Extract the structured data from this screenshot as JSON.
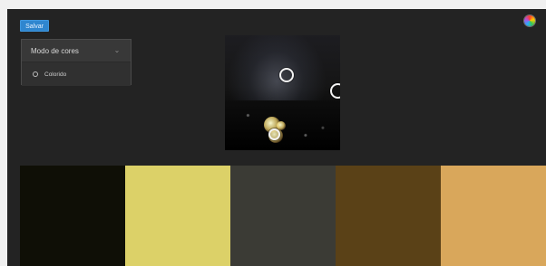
{
  "toolbar": {
    "save_label": "Salvar"
  },
  "settings_panel": {
    "title": "Modo de cores",
    "options": [
      {
        "label": "Colorido",
        "selected": false
      }
    ]
  },
  "palette": {
    "colors": [
      "#0f0f06",
      "#dcd168",
      "#3b3b35",
      "#5a4117",
      "#d9a75b"
    ]
  },
  "icons": {
    "theme_wheel": "color-wheel-icon",
    "collapse": "chevron-down-double-icon"
  }
}
